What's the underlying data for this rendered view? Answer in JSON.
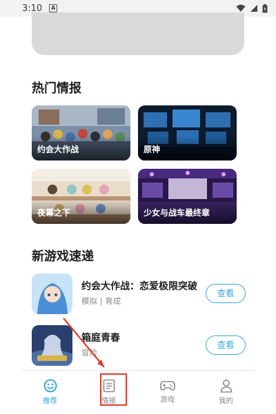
{
  "status_bar": {
    "time": "3:10",
    "notification_glyph": "A"
  },
  "sections": {
    "hot_news": "热门情报",
    "new_games": "新游戏速递"
  },
  "news_cards": [
    {
      "title": "约会大作战"
    },
    {
      "title": "原神"
    },
    {
      "title": "夜幕之下"
    },
    {
      "title": "少女与战车最终章"
    }
  ],
  "games": [
    {
      "name": "约会大作战：恋爱极限突破",
      "meta": "模拟 | 育成",
      "button": "查看"
    },
    {
      "name": "箱庭青春",
      "meta": "冒险",
      "button": "查看"
    }
  ],
  "tabs": [
    {
      "label": "推荐",
      "icon": "smiley-icon",
      "active": true
    },
    {
      "label": "情报",
      "icon": "document-icon",
      "active": false
    },
    {
      "label": "游戏",
      "icon": "gamepad-icon",
      "active": false
    },
    {
      "label": "我的",
      "icon": "person-icon",
      "active": false
    }
  ],
  "colors": {
    "accent": "#39a7e0",
    "annotation": "#e23b2b",
    "banner": "#d9d9d9"
  }
}
